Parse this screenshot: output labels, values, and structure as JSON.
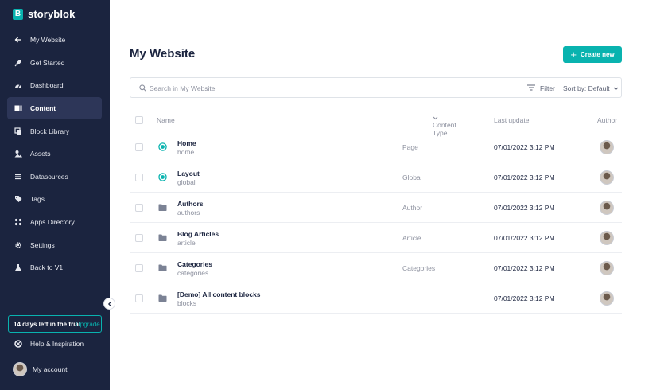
{
  "colors": {
    "sidebar_bg": "#1b243f",
    "accent": "#09b3af",
    "text_dark": "#1b243f",
    "text_muted": "#8d919f"
  },
  "sidebar": {
    "logo_mark": "B",
    "logo_text": "storyblok",
    "items": [
      {
        "label": "My Website",
        "icon": "arrow-left-icon"
      },
      {
        "label": "Get Started",
        "icon": "rocket-icon"
      },
      {
        "label": "Dashboard",
        "icon": "gauge-icon"
      },
      {
        "label": "Content",
        "icon": "content-icon",
        "active": true
      },
      {
        "label": "Block Library",
        "icon": "blocks-icon"
      },
      {
        "label": "Assets",
        "icon": "assets-icon"
      },
      {
        "label": "Datasources",
        "icon": "list-icon"
      },
      {
        "label": "Tags",
        "icon": "tag-icon"
      },
      {
        "label": "Apps Directory",
        "icon": "apps-icon"
      },
      {
        "label": "Settings",
        "icon": "gear-icon"
      },
      {
        "label": "Back to V1",
        "icon": "flask-icon"
      }
    ],
    "trial_text": "14 days left in the trial",
    "upgrade_text": "Upgrade",
    "help_label": "Help & Inspiration",
    "account_label": "My account"
  },
  "main": {
    "title": "My Website",
    "create_label": "Create new",
    "search_placeholder": "Search in My Website",
    "filter_label": "Filter",
    "sort_label": "Sort by: Default",
    "columns": {
      "name": "Name",
      "content_type": "Content Type",
      "last_update": "Last update",
      "author": "Author"
    },
    "rows": [
      {
        "name": "Home",
        "slug": "home",
        "content_type": "Page",
        "last_update": "07/01/2022 3:12 PM",
        "kind": "story"
      },
      {
        "name": "Layout",
        "slug": "global",
        "content_type": "Global",
        "last_update": "07/01/2022 3:12 PM",
        "kind": "story"
      },
      {
        "name": "Authors",
        "slug": "authors",
        "content_type": "Author",
        "last_update": "07/01/2022 3:12 PM",
        "kind": "folder"
      },
      {
        "name": "Blog Articles",
        "slug": "article",
        "content_type": "Article",
        "last_update": "07/01/2022 3:12 PM",
        "kind": "folder"
      },
      {
        "name": "Categories",
        "slug": "categories",
        "content_type": "Categories",
        "last_update": "07/01/2022 3:12 PM",
        "kind": "folder"
      },
      {
        "name": "[Demo] All content blocks",
        "slug": "blocks",
        "content_type": "",
        "last_update": "07/01/2022 3:12 PM",
        "kind": "folder"
      }
    ]
  }
}
